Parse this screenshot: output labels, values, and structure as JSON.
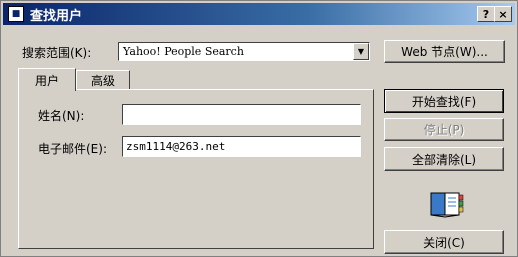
{
  "titlebar": {
    "title": "查找用户",
    "help": "?",
    "close": "×",
    "icon_name": "find-people-icon"
  },
  "search": {
    "scope_label": "搜索范围(K):",
    "scope_value": "Yahoo! People Search",
    "web_button": "Web 节点(W)..."
  },
  "tabs": [
    {
      "label": "用户"
    },
    {
      "label": "高级"
    }
  ],
  "form": {
    "name_label": "姓名(N):",
    "name_value": "",
    "email_label": "电子邮件(E):",
    "email_value": "zsm1114@263.net"
  },
  "buttons": {
    "start": "开始查找(F)",
    "stop": "停止(P)",
    "clear": "全部清除(L)",
    "close": "关闭(C)"
  },
  "colors": {
    "title_start": "#0a246a",
    "title_end": "#a6caf0",
    "face": "#d4d0c8"
  }
}
